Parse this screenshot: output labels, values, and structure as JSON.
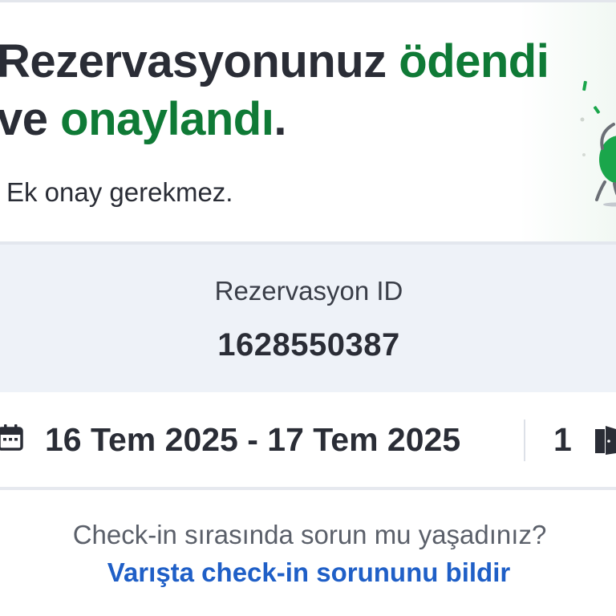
{
  "confirmation": {
    "title_part1": "Rezervasyonunuz ",
    "title_highlight_1": "ödendi",
    "title_part2": " ve ",
    "title_highlight_2": "onaylandı",
    "title_end": ".",
    "subtext": "Ek onay gerekmez."
  },
  "reservation": {
    "id_label": "Rezervasyon ID",
    "id_value": "1628550387"
  },
  "stay": {
    "dates": "16 Tem 2025 - 17 Tem 2025",
    "room_count": "1",
    "calendar_icon": "calendar-icon",
    "room_icon": "door-icon"
  },
  "help": {
    "question": "Check-in sırasında sorun mu yaşadınız?",
    "link_label": "Varışta check-in sorununu bildir"
  },
  "colors": {
    "accent_green": "#0f7a36",
    "link_blue": "#1f5fc7",
    "panel_bg": "#eef2f8",
    "text_dark": "#2a2d36",
    "text_muted": "#5b606a"
  }
}
